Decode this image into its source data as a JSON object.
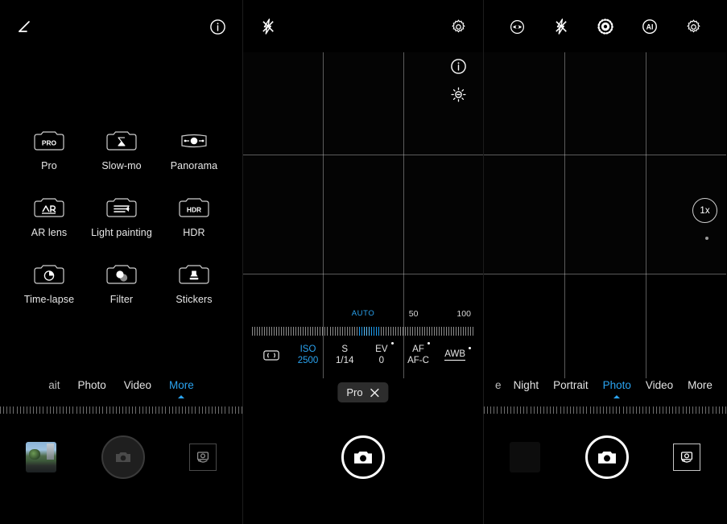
{
  "app": {
    "title": "Camera"
  },
  "colors": {
    "accent": "#2aa3f0",
    "text": "#e8e8e8",
    "background": "#000000",
    "chip": "#2d2d2d"
  },
  "left_panel": {
    "topbar": {
      "left_icon": "exposure-adjust-icon",
      "right_icon": "info-icon"
    },
    "modes": [
      {
        "label": "Pro",
        "icon": "mode-pro-icon",
        "glyph": "PRO"
      },
      {
        "label": "Slow-mo",
        "icon": "mode-slowmo-icon",
        "glyph": "hourglass"
      },
      {
        "label": "Panorama",
        "icon": "mode-panorama-icon",
        "glyph": "panorama"
      },
      {
        "label": "AR lens",
        "icon": "mode-ar-lens-icon",
        "glyph": "AR"
      },
      {
        "label": "Light painting",
        "icon": "mode-light-painting-icon",
        "glyph": "streaks"
      },
      {
        "label": "HDR",
        "icon": "mode-hdr-icon",
        "glyph": "HDR"
      },
      {
        "label": "Time-lapse",
        "icon": "mode-time-lapse-icon",
        "glyph": "clock"
      },
      {
        "label": "Filter",
        "icon": "mode-filter-icon",
        "glyph": "circles"
      },
      {
        "label": "Stickers",
        "icon": "mode-stickers-icon",
        "glyph": "stamp"
      }
    ],
    "tabs": [
      {
        "label": "ait",
        "active": false,
        "clipped": true
      },
      {
        "label": "Photo",
        "active": false,
        "clipped": false
      },
      {
        "label": "Video",
        "active": false,
        "clipped": false
      },
      {
        "label": "More",
        "active": true,
        "clipped": false
      }
    ],
    "bottom": {
      "thumbnail": "gallery-thumbnail",
      "shutter": "shutter-button",
      "flip": "flip-camera-icon"
    }
  },
  "mid_panel": {
    "topbar": {
      "flash": "flash-off-icon",
      "settings": "gear-icon"
    },
    "side_icons": [
      {
        "name": "info-icon"
      },
      {
        "name": "brightness-icon"
      }
    ],
    "pro_controls": {
      "slider": {
        "labels": [
          {
            "text": "AUTO",
            "pos": 50,
            "accent": true
          },
          {
            "text": "50",
            "pos": 71,
            "accent": false
          },
          {
            "text": "100",
            "pos": 92,
            "accent": false
          }
        ],
        "tick_count": 92,
        "highlight_start": 44,
        "highlight_end": 52
      },
      "cells": [
        {
          "key": "metering",
          "icon": "metering-icon",
          "key_label": "",
          "value": "",
          "active": false,
          "dot": false,
          "underline": false
        },
        {
          "key": "iso",
          "icon": "",
          "key_label": "ISO",
          "value": "2500",
          "active": true,
          "dot": false,
          "underline": false
        },
        {
          "key": "shutter",
          "icon": "",
          "key_label": "S",
          "value": "1/14",
          "active": false,
          "dot": false,
          "underline": false
        },
        {
          "key": "ev",
          "icon": "",
          "key_label": "EV",
          "value": "0",
          "active": false,
          "dot": true,
          "underline": false
        },
        {
          "key": "af",
          "icon": "",
          "key_label": "AF",
          "value": "AF-C",
          "active": false,
          "dot": true,
          "underline": false
        },
        {
          "key": "wb",
          "icon": "",
          "key_label": "AWB",
          "value": "",
          "active": false,
          "dot": true,
          "underline": true
        }
      ]
    },
    "pro_chip": {
      "label": "Pro",
      "close_icon": "close-icon"
    },
    "bottom": {
      "shutter": "shutter-button"
    }
  },
  "right_panel": {
    "topbar": [
      {
        "name": "aperture-eye-icon"
      },
      {
        "name": "flash-off-icon"
      },
      {
        "name": "beauty-dotted-circle-icon"
      },
      {
        "name": "ai-scene-icon"
      },
      {
        "name": "gear-icon"
      }
    ],
    "zoom": {
      "level": "1x"
    },
    "tabs": [
      {
        "label": "e",
        "active": false,
        "clipped": true
      },
      {
        "label": "Night",
        "active": false,
        "clipped": false
      },
      {
        "label": "Portrait",
        "active": false,
        "clipped": false
      },
      {
        "label": "Photo",
        "active": true,
        "clipped": false
      },
      {
        "label": "Video",
        "active": false,
        "clipped": false
      },
      {
        "label": "More",
        "active": false,
        "clipped": false
      }
    ],
    "bottom": {
      "thumbnail": "gallery-thumbnail",
      "shutter": "shutter-button",
      "flip": "flip-camera-icon"
    }
  }
}
